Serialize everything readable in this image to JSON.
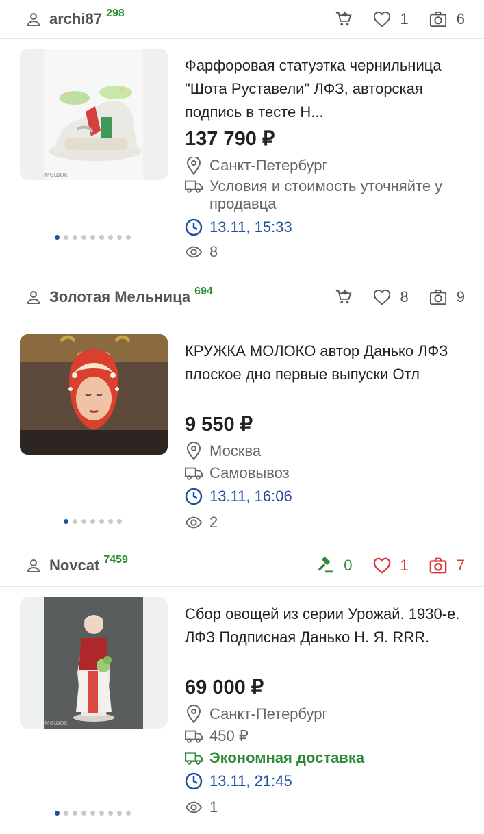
{
  "colors": {
    "accent_blue": "#1f4fa0",
    "green": "#2e8b3a",
    "red": "#d73a3a",
    "grey": "#666666"
  },
  "top_bar": {
    "username": "archi87",
    "rating": "298",
    "likes": "1",
    "photos": "6"
  },
  "listings": [
    {
      "title": "Фарфоровая статуэтка чернильница \"Шота Руставели\" ЛФЗ, авторская подпись в тесте Н...",
      "price": "137 790 ₽",
      "location": "Санкт-Петербург",
      "delivery": "Условия и стоимость уточняйте у продавца",
      "time": "13.11, 15:33",
      "views": "8",
      "image_watermark": "мешок",
      "dot_count": 9,
      "active_dot": 0,
      "seller": {
        "username": "Золотая Мельница",
        "rating": "694",
        "likes": "8",
        "photos": "9"
      }
    },
    {
      "title": "КРУЖКА МОЛОКО автор Данько ЛФЗ плоское дно первые выпуски Отл",
      "price": "9 550 ₽",
      "location": "Москва",
      "delivery": "Самовывоз",
      "time": "13.11, 16:06",
      "views": "2",
      "dot_count": 7,
      "active_dot": 0,
      "seller": {
        "username": "Novcat",
        "rating": "7459",
        "bids": "0",
        "likes": "1",
        "photos": "7"
      }
    },
    {
      "title": "Сбор овощей из серии Урожай. 1930-е. ЛФЗ Подписная Данько Н. Я. RRR.",
      "price": "69 000 ₽",
      "location": "Санкт-Петербург",
      "delivery_price": "450 ₽",
      "delivery_option": "Экономная доставка",
      "time": "13.11, 21:45",
      "views": "1",
      "image_watermark": "мешок",
      "dot_count": 9,
      "active_dot": 0
    }
  ]
}
